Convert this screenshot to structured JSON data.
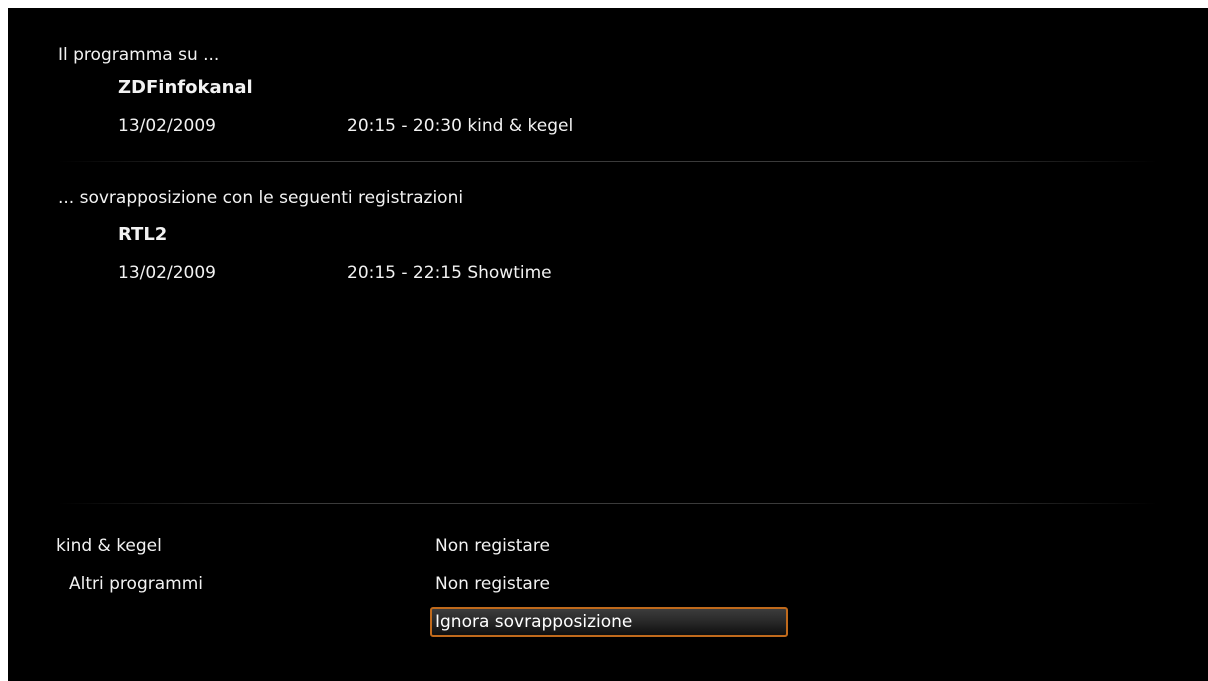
{
  "conflict": {
    "header": "Il programma su ...",
    "channel": "ZDFinfokanal",
    "date": "13/02/2009",
    "program": "20:15 - 20:30 kind & kegel"
  },
  "overlap": {
    "header": "... sovrapposizione con le seguenti registrazioni",
    "channel": "RTL2",
    "date": "13/02/2009",
    "program": "20:15 - 22:15 Showtime"
  },
  "options": {
    "rows": [
      {
        "label": "kind & kegel",
        "value": "Non registare"
      },
      {
        "label": "Altri programmi",
        "value": "Non registare"
      }
    ],
    "ignore_button": "Ignora sovrapposizione"
  },
  "colors": {
    "background": "#000000",
    "text": "#f2f2f2",
    "focus_border": "#c06a1c"
  }
}
